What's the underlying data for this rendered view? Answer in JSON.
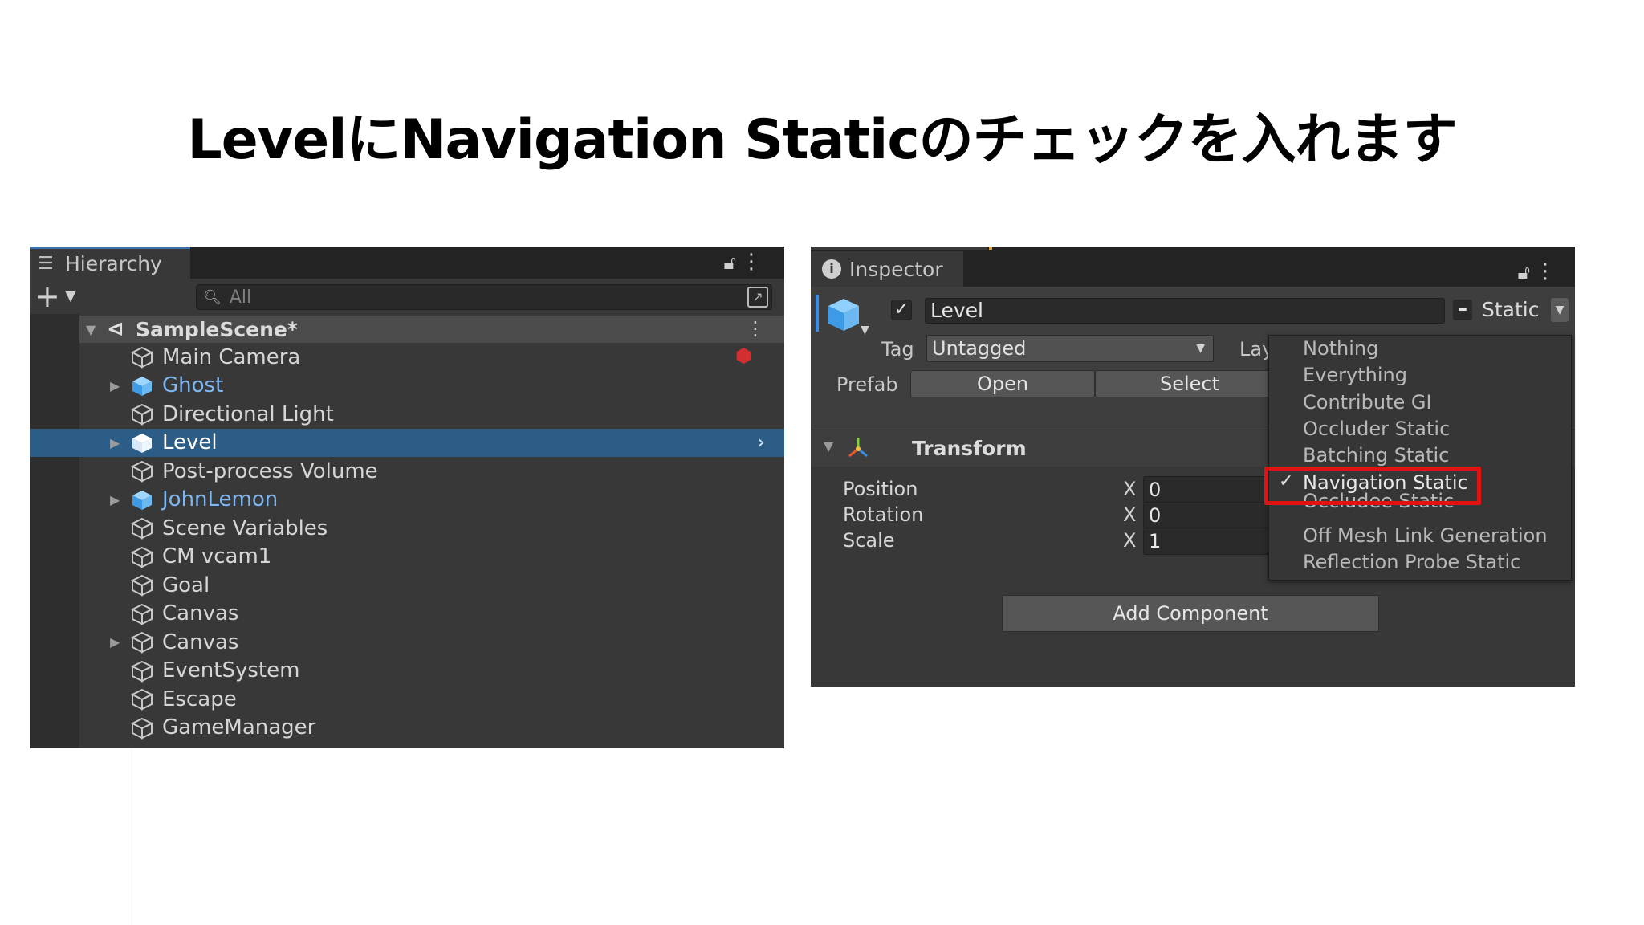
{
  "slide": {
    "title": "LevelにNavigation Staticのチェックを入れます"
  },
  "hierarchy": {
    "tab_label": "Hierarchy",
    "search_placeholder": "All",
    "scene_name": "SampleScene*",
    "items": [
      {
        "label": "Main Camera",
        "prefab": false,
        "foldable": false,
        "selected": false
      },
      {
        "label": "Ghost",
        "prefab": true,
        "foldable": true,
        "selected": false
      },
      {
        "label": "Directional Light",
        "prefab": false,
        "foldable": false,
        "selected": false
      },
      {
        "label": "Level",
        "prefab": true,
        "foldable": true,
        "selected": true
      },
      {
        "label": "Post-process Volume",
        "prefab": false,
        "foldable": false,
        "selected": false
      },
      {
        "label": "JohnLemon",
        "prefab": true,
        "foldable": true,
        "selected": false
      },
      {
        "label": "Scene Variables",
        "prefab": false,
        "foldable": false,
        "selected": false
      },
      {
        "label": "CM vcam1",
        "prefab": false,
        "foldable": false,
        "selected": false
      },
      {
        "label": "Goal",
        "prefab": false,
        "foldable": false,
        "selected": false
      },
      {
        "label": "Canvas",
        "prefab": false,
        "foldable": false,
        "selected": false
      },
      {
        "label": "Canvas",
        "prefab": false,
        "foldable": true,
        "selected": false
      },
      {
        "label": "EventSystem",
        "prefab": false,
        "foldable": false,
        "selected": false
      },
      {
        "label": "Escape",
        "prefab": false,
        "foldable": false,
        "selected": false
      },
      {
        "label": "GameManager",
        "prefab": false,
        "foldable": false,
        "selected": false
      }
    ]
  },
  "inspector": {
    "tab_label": "Inspector",
    "object_name": "Level",
    "static_label": "Static",
    "tag_label": "Tag",
    "tag_value": "Untagged",
    "layer_label": "Lay",
    "prefab_label": "Prefab",
    "open_button": "Open",
    "select_button": "Select",
    "component_title": "Transform",
    "properties": [
      {
        "label": "Position",
        "axis": "X",
        "value": "0"
      },
      {
        "label": "Rotation",
        "axis": "X",
        "value": "0"
      },
      {
        "label": "Scale",
        "axis": "X",
        "value": "1"
      }
    ],
    "add_component_button": "Add Component"
  },
  "static_menu": {
    "items": [
      {
        "label": "Nothing",
        "checked": false
      },
      {
        "label": "Everything",
        "checked": false
      },
      {
        "label": "Contribute GI",
        "checked": false
      },
      {
        "label": "Occluder Static",
        "checked": false
      },
      {
        "label": "Batching Static",
        "checked": false
      },
      {
        "label": "Navigation Static",
        "checked": true
      },
      {
        "label": "Occludee Static",
        "checked": false
      },
      {
        "label": "Off Mesh Link Generation",
        "checked": false
      },
      {
        "label": "Reflection Probe Static",
        "checked": false
      }
    ],
    "highlight_color": "#e01212"
  },
  "colors": {
    "panel_bg": "#383838",
    "selection": "#2c5d87",
    "prefab_text": "#7db7f2"
  }
}
